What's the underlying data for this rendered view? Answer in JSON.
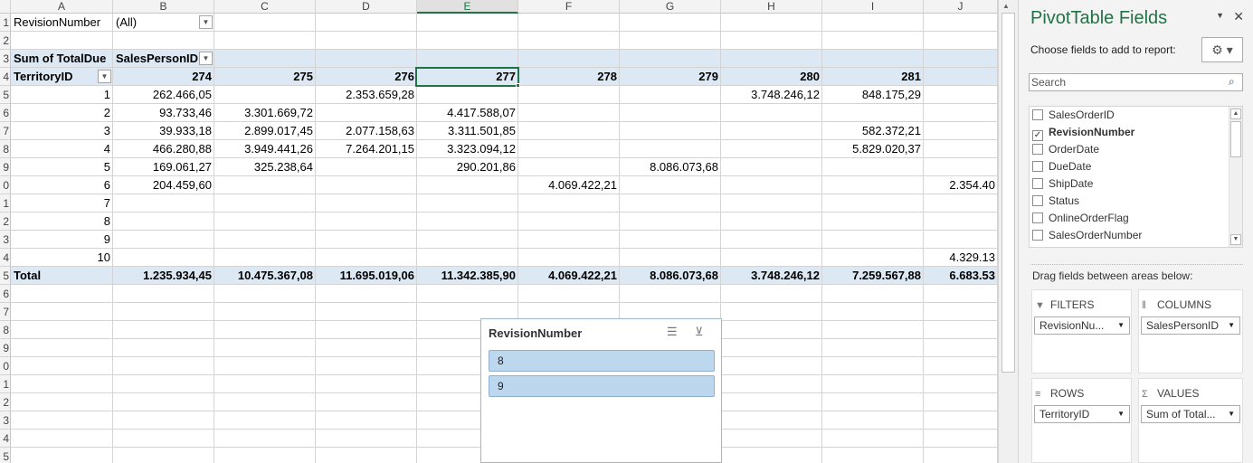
{
  "columns": [
    "A",
    "B",
    "C",
    "D",
    "E",
    "F",
    "G",
    "H",
    "I",
    "J"
  ],
  "selected_column": "E",
  "row_numbers": [
    "1",
    "2",
    "3",
    "4",
    "5",
    "6",
    "7",
    "8",
    "9",
    "0",
    "1",
    "2",
    "3",
    "4",
    "5",
    "6",
    "7",
    "8",
    "9",
    "0",
    "1",
    "2",
    "3",
    "4",
    "5"
  ],
  "filter": {
    "label": "RevisionNumber",
    "value": "(All)"
  },
  "pivot": {
    "values_label": "Sum of TotalDue",
    "columns_label": "SalesPersonID",
    "rows_label": "TerritoryID",
    "col_ids": [
      "274",
      "275",
      "276",
      "277",
      "278",
      "279",
      "280",
      "281"
    ],
    "rows": [
      {
        "id": "1",
        "cells": [
          "262.466,05",
          "",
          "2.353.659,28",
          "",
          "",
          "",
          "3.748.246,12",
          "848.175,29",
          ""
        ]
      },
      {
        "id": "2",
        "cells": [
          "93.733,46",
          "3.301.669,72",
          "",
          "4.417.588,07",
          "",
          "",
          "",
          "",
          ""
        ]
      },
      {
        "id": "3",
        "cells": [
          "39.933,18",
          "2.899.017,45",
          "2.077.158,63",
          "3.311.501,85",
          "",
          "",
          "",
          "582.372,21",
          ""
        ]
      },
      {
        "id": "4",
        "cells": [
          "466.280,88",
          "3.949.441,26",
          "7.264.201,15",
          "3.323.094,12",
          "",
          "",
          "",
          "5.829.020,37",
          ""
        ]
      },
      {
        "id": "5",
        "cells": [
          "169.061,27",
          "325.238,64",
          "",
          "290.201,86",
          "",
          "8.086.073,68",
          "",
          "",
          ""
        ]
      },
      {
        "id": "6",
        "cells": [
          "204.459,60",
          "",
          "",
          "",
          "4.069.422,21",
          "",
          "",
          "",
          "2.354.40"
        ]
      },
      {
        "id": "7",
        "cells": [
          "",
          "",
          "",
          "",
          "",
          "",
          "",
          "",
          ""
        ]
      },
      {
        "id": "8",
        "cells": [
          "",
          "",
          "",
          "",
          "",
          "",
          "",
          "",
          ""
        ]
      },
      {
        "id": "9",
        "cells": [
          "",
          "",
          "",
          "",
          "",
          "",
          "",
          "",
          ""
        ]
      },
      {
        "id": "10",
        "cells": [
          "",
          "",
          "",
          "",
          "",
          "",
          "",
          "",
          "4.329.13"
        ]
      }
    ],
    "total_label": "Total",
    "totals": [
      "1.235.934,45",
      "10.475.367,08",
      "11.695.019,06",
      "11.342.385,90",
      "4.069.422,21",
      "8.086.073,68",
      "3.748.246,12",
      "7.259.567,88",
      "6.683.53"
    ]
  },
  "slicer": {
    "title": "RevisionNumber",
    "items": [
      "8",
      "9"
    ]
  },
  "pane": {
    "title": "PivotTable Fields",
    "choose_text": "Choose fields to add to report:",
    "search_placeholder": "Search",
    "fields": [
      {
        "name": "SalesOrderID",
        "checked": false
      },
      {
        "name": "RevisionNumber",
        "checked": true
      },
      {
        "name": "OrderDate",
        "checked": false
      },
      {
        "name": "DueDate",
        "checked": false
      },
      {
        "name": "ShipDate",
        "checked": false
      },
      {
        "name": "Status",
        "checked": false
      },
      {
        "name": "OnlineOrderFlag",
        "checked": false
      },
      {
        "name": "SalesOrderNumber",
        "checked": false
      }
    ],
    "drag_text": "Drag fields between areas below:",
    "areas": {
      "filters": {
        "label": "FILTERS",
        "chip": "RevisionNu..."
      },
      "columns": {
        "label": "COLUMNS",
        "chip": "SalesPersonID"
      },
      "rows": {
        "label": "ROWS",
        "chip": "TerritoryID"
      },
      "values": {
        "label": "VALUES",
        "chip": "Sum of Total..."
      }
    }
  }
}
